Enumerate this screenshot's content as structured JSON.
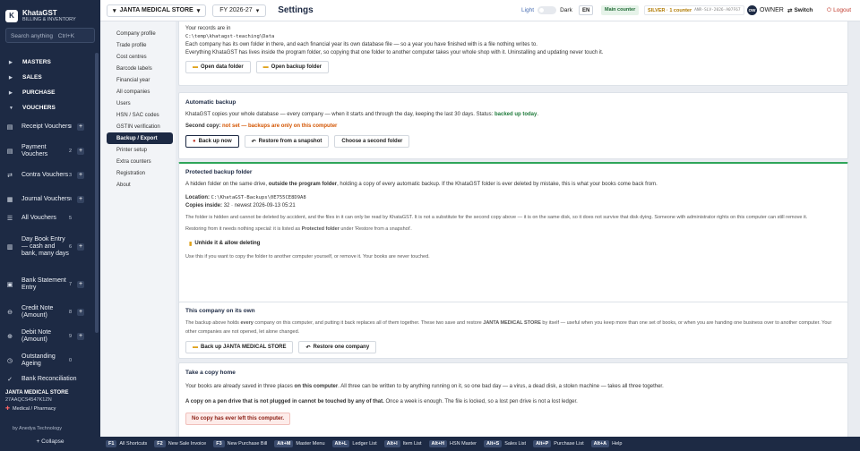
{
  "sidebar": {
    "brand": {
      "name": "KhataGST",
      "sub": "BILLING & INVENTORY"
    },
    "search": {
      "placeholder": "Search anything",
      "kbd": "Ctrl+K"
    },
    "groups": [
      "MASTERS",
      "SALES",
      "PURCHASE",
      "VOUCHERS"
    ],
    "vouchers": [
      {
        "label": "Receipt Vouchers",
        "count": "3"
      },
      {
        "label": "Payment Vouchers",
        "count": "2"
      },
      {
        "label": "Contra Vouchers",
        "count": "3"
      },
      {
        "label": "Journal Vouchers",
        "count": "4"
      },
      {
        "label": "All Vouchers",
        "count": "5"
      },
      {
        "label": "Day Book Entry — cash and bank, many days",
        "count": "6"
      },
      {
        "label": "Bank Statement Entry",
        "count": "7"
      },
      {
        "label": "Credit Note (Amount)",
        "count": "8"
      },
      {
        "label": "Debit Note (Amount)",
        "count": "9"
      },
      {
        "label": "Outstanding Ageing",
        "count": "0"
      },
      {
        "label": "Bank Reconciliation",
        "count": ""
      }
    ],
    "company": {
      "name": "JANTA MEDICAL STORE",
      "gstin": "27AAQCS4547K1ZN",
      "type": "Medical / Pharmacy"
    },
    "by": "by Anedya Technology",
    "collapse": "+ Collapse"
  },
  "topbar": {
    "company": "JANTA MEDICAL STORE",
    "fy": "FY 2026-27",
    "title": "Settings",
    "light": "Light",
    "dark": "Dark",
    "lang": "EN",
    "main_counter": "Main counter",
    "license": "SILVER · 1 counter",
    "license_key": "ANR-SLV-2026-A07F67",
    "owner": "OWNER",
    "owner_initials": "OW",
    "switch": "Switch",
    "logout": "Logout"
  },
  "settings_nav": [
    "Company profile",
    "Trade profile",
    "Cost centres",
    "Barcode labels",
    "Financial year",
    "All companies",
    "Users",
    "HSN / SAC codes",
    "GSTIN verification",
    "Backup / Export",
    "Printer setup",
    "Extra counters",
    "Registration",
    "About"
  ],
  "settings_nav_active": "Backup / Export",
  "records": {
    "line1": "Your records are in",
    "path": "C:\\temp\\khatagst-teaching\\Data",
    "line2": "Each company has its own folder in there, and each financial year its own database file — so a year you have finished with is a file nothing writes to.",
    "line3": "Everything KhataGST has lives inside the program folder, so copying that one folder to another computer takes your whole shop with it. Uninstalling and updating never touch it.",
    "btn_open_data": "Open data folder",
    "btn_open_backup": "Open backup folder"
  },
  "auto": {
    "title": "Automatic backup",
    "desc": "KhataGST copies your whole database — every company — when it starts and through the day, keeping the last 30 days. Status:",
    "status": "backed up today",
    "second_label": "Second copy:",
    "second_val": "not set — backups are only on this computer",
    "btn_backup": "Back up now",
    "btn_restore": "Restore from a snapshot",
    "btn_second": "Choose a second folder"
  },
  "protected": {
    "title": "Protected backup folder",
    "desc1": "A hidden folder on the same drive,",
    "desc_bold": "outside the program folder",
    "desc2": ", holding a copy of every automatic backup. If the KhataGST folder is ever deleted by mistake, this is what your books come back from.",
    "location_label": "Location:",
    "location": "C:\\KhataGST-Backups\\0E755CE8D9A8",
    "copies_label": "Copies inside:",
    "copies": "32 · newest 2026-09-13 05:21",
    "note1": "The folder is hidden and cannot be deleted by accident, and the files in it can only be read by KhataGST. It is not a substitute for the second copy above — it is on the same disk, so it does not survive that disk dying. Someone with administrator rights on this computer can still remove it.",
    "note2a": "Restoring from it needs nothing special: it is listed as",
    "note2b": "Protected folder",
    "note2c": "under 'Restore from a snapshot'.",
    "btn_unhide": "Unhide it & allow deleting",
    "note3": "Use this if you want to copy the folder to another computer yourself, or remove it. Your books are never touched."
  },
  "thisco": {
    "title": "This company on its own",
    "desc_a": "The backup above holds",
    "desc_b": "every",
    "desc_c": "company on this computer, and putting it back replaces all of them together. These two save and restore",
    "desc_d": "JANTA MEDICAL STORE",
    "desc_e": "by itself — useful when you keep more than one set of books, or when you are handing one business over to another computer. Your other companies are not opened, let alone changed.",
    "btn_backup": "Back up JANTA MEDICAL STORE",
    "btn_restore": "Restore one company"
  },
  "copyhome": {
    "title": "Take a copy home",
    "desc_a": "Your books are already saved in three places",
    "desc_b": "on this computer",
    "desc_c": ". All three can be written to by anything running on it, so one bad day — a virus, a dead disk, a stolen machine — takes all three together.",
    "desc2_a": "A copy on a pen drive that is",
    "desc2_b": "not plugged in cannot be touched by any of that.",
    "desc2_c": "Once a week is enough. The file is locked, so a lost pen drive is not a lost ledger.",
    "warn": "No copy has ever left this computer."
  },
  "shortcuts": [
    {
      "k": "F1",
      "l": "All Shortcuts"
    },
    {
      "k": "F2",
      "l": "New Sale Invoice"
    },
    {
      "k": "F3",
      "l": "New Purchase Bill"
    },
    {
      "k": "Alt+M",
      "l": "Master Menu"
    },
    {
      "k": "Alt+L",
      "l": "Ledger List"
    },
    {
      "k": "Alt+I",
      "l": "Item List"
    },
    {
      "k": "Alt+H",
      "l": "HSN Master"
    },
    {
      "k": "Alt+S",
      "l": "Sales List"
    },
    {
      "k": "Alt+P",
      "l": "Purchase List"
    },
    {
      "k": "Alt+A",
      "l": "Help"
    }
  ],
  "colors": {
    "navy": "#1d2a44",
    "accent_green": "#2fa55a",
    "warn_orange": "#d35400",
    "danger": "#c0392b"
  }
}
